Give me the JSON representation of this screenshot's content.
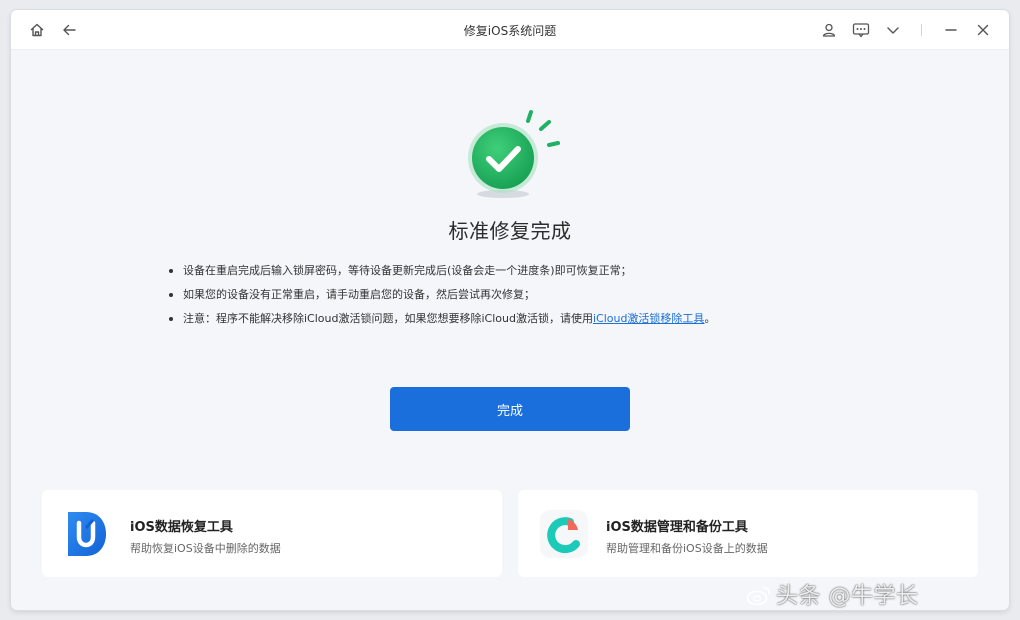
{
  "window": {
    "title": "修复iOS系统问题"
  },
  "titlebar_icons": {
    "home": "home-icon",
    "back": "back-arrow-icon",
    "user": "user-icon",
    "feedback": "feedback-icon",
    "menu": "chevron-down-icon",
    "minimize": "minimize-icon",
    "close": "close-icon"
  },
  "status": {
    "icon": "check-circle-icon",
    "title": "标准修复完成"
  },
  "notes": [
    {
      "text": "设备在重启完成后输入锁屏密码，等待设备更新完成后(设备会走一个进度条)即可恢复正常；"
    },
    {
      "text": "如果您的设备没有正常重启，请手动重启您的设备，然后尝试再次修复；"
    },
    {
      "text": "注意：程序不能解决移除iCloud激活锁问题，如果您想要移除iCloud激活锁，请使用",
      "link": "iCloud激活锁移除工具",
      "suffix": "。"
    }
  ],
  "done_button": {
    "label": "完成"
  },
  "cards": [
    {
      "title": "iOS数据恢复工具",
      "desc": "帮助恢复iOS设备中删除的数据",
      "icon": "data-recovery-icon"
    },
    {
      "title": "iOS数据管理和备份工具",
      "desc": "帮助管理和备份iOS设备上的数据",
      "icon": "data-manager-icon"
    }
  ],
  "watermark": {
    "text": "头条 @牛学长"
  },
  "colors": {
    "accent": "#1b6fdc",
    "success": "#1faa5a",
    "link": "#1a6fd8"
  }
}
